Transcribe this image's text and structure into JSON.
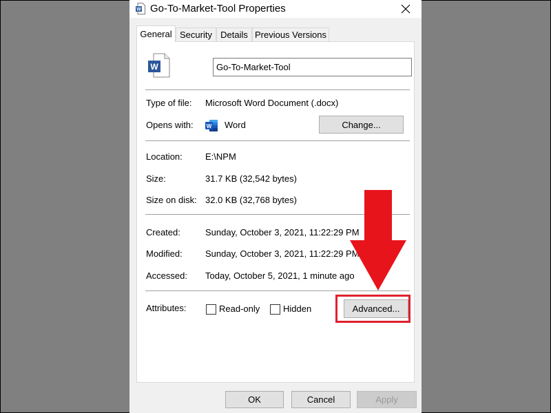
{
  "window": {
    "title": "Go-To-Market-Tool Properties",
    "close_glyph": "✕"
  },
  "tabs": [
    {
      "label": "General",
      "active": true
    },
    {
      "label": "Security",
      "active": false
    },
    {
      "label": "Details",
      "active": false
    },
    {
      "label": "Previous Versions",
      "active": false
    }
  ],
  "general": {
    "file_name": "Go-To-Market-Tool",
    "type_of_file": {
      "label": "Type of file:",
      "value": "Microsoft Word Document (.docx)"
    },
    "opens_with": {
      "label": "Opens with:",
      "value": "Word",
      "change_label": "Change..."
    },
    "location": {
      "label": "Location:",
      "value": "E:\\NPM"
    },
    "size": {
      "label": "Size:",
      "value": "31.7 KB (32,542 bytes)"
    },
    "size_on_disk": {
      "label": "Size on disk:",
      "value": "32.0 KB (32,768 bytes)"
    },
    "created": {
      "label": "Created:",
      "value": "Sunday, October 3, 2021, 11:22:29 PM"
    },
    "modified": {
      "label": "Modified:",
      "value": "Sunday, October 3, 2021, 11:22:29 PM"
    },
    "accessed": {
      "label": "Accessed:",
      "value": "Today, October 5, 2021, 1 minute ago"
    },
    "attributes": {
      "label": "Attributes:",
      "read_only": {
        "label": "Read-only",
        "checked": false
      },
      "hidden": {
        "label": "Hidden",
        "checked": false
      },
      "advanced_label": "Advanced..."
    }
  },
  "footer": {
    "ok_label": "OK",
    "cancel_label": "Cancel",
    "apply_label": "Apply"
  },
  "annotation": {
    "arrow_color": "#e8141c",
    "highlight_color": "#e0202c"
  },
  "icons": {
    "title": "word-document-icon",
    "file": "word-document-icon",
    "app": "word-app-icon"
  }
}
